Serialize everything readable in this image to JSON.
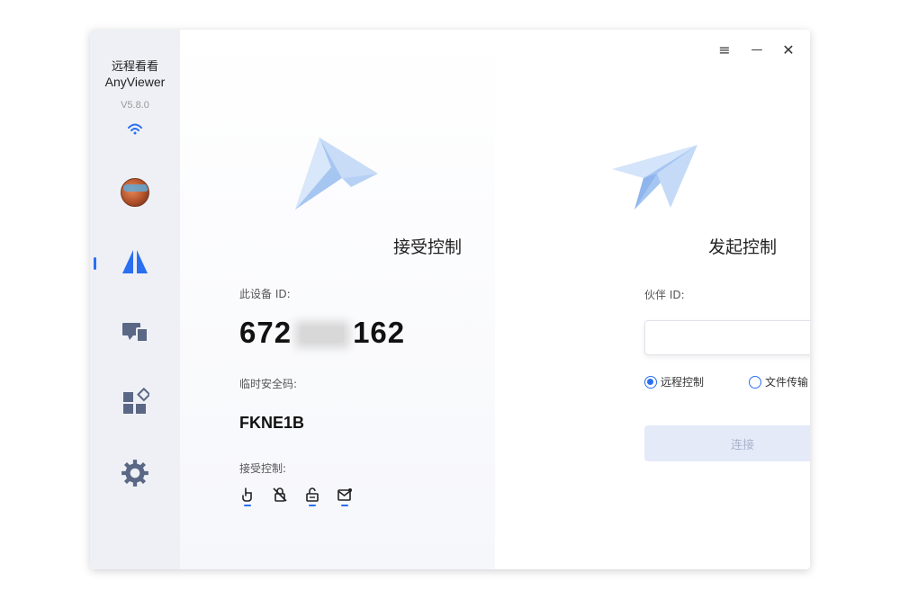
{
  "app": {
    "name_cn": "远程看看",
    "name_en": "AnyViewer",
    "version": "V5.8.0"
  },
  "sidebar": {
    "items": [
      {
        "name": "profile",
        "icon": "avatar"
      },
      {
        "name": "remote-control",
        "icon": "anyviewer-logo-icon",
        "active": true
      },
      {
        "name": "devices",
        "icon": "devices-icon"
      },
      {
        "name": "apps",
        "icon": "apps-icon"
      },
      {
        "name": "settings",
        "icon": "gear-icon"
      }
    ]
  },
  "window_controls": {
    "menu": "≡",
    "minimize": "—",
    "close": "✕"
  },
  "receive": {
    "title": "接受控制",
    "device_id_label": "此设备 ID:",
    "device_id_prefix": "672",
    "device_id_suffix": "162",
    "temp_code_label": "临时安全码:",
    "temp_code": "FKNE1B",
    "accept_label": "接受控制:"
  },
  "initiate": {
    "title": "发起控制",
    "partner_label": "伙伴 ID:",
    "partner_value": "",
    "options": [
      {
        "label": "远程控制",
        "checked": true
      },
      {
        "label": "文件传输",
        "checked": false
      }
    ],
    "connect_label": "连接"
  },
  "colors": {
    "accent": "#2b6ff0",
    "sidebar_bg": "#eef0f5",
    "connect_disabled_bg": "#e4eaf8",
    "connect_disabled_text": "#aab4cc"
  }
}
